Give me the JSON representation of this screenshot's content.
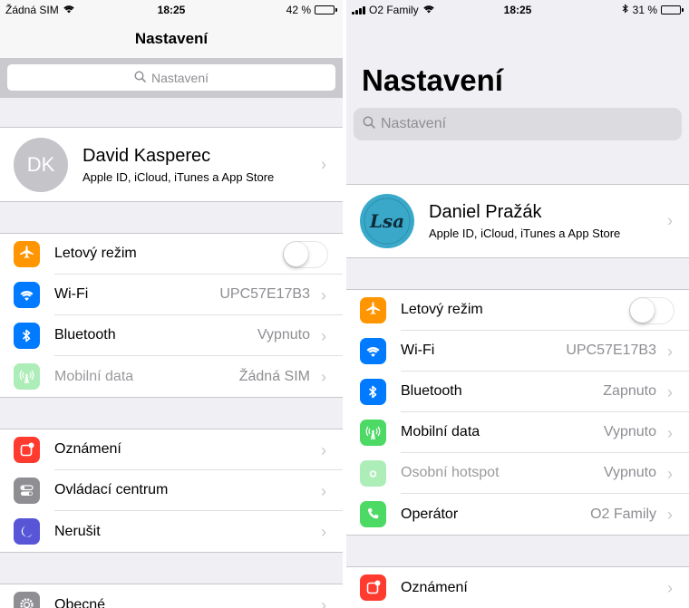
{
  "left": {
    "status": {
      "carrier": "Žádná SIM",
      "time": "18:25",
      "battery": "42 %",
      "battery_level": 0.42
    },
    "nav_title": "Nastavení",
    "search_placeholder": "Nastavení",
    "profile": {
      "initials": "DK",
      "name": "David Kasperec",
      "subtitle": "Apple ID, iCloud, iTunes a App Store"
    },
    "group1": [
      {
        "label": "Letový režim",
        "icon": "airplane-icon",
        "color": "#ff9500",
        "toggle": true
      },
      {
        "label": "Wi-Fi",
        "icon": "wifi-icon",
        "color": "#007aff",
        "value": "UPC57E17B3"
      },
      {
        "label": "Bluetooth",
        "icon": "bluetooth-icon",
        "color": "#007aff",
        "value": "Vypnuto"
      },
      {
        "label": "Mobilní data",
        "icon": "cellular-icon",
        "color": "#4cd964",
        "value": "Žádná SIM",
        "dim": true
      }
    ],
    "group2": [
      {
        "label": "Oznámení",
        "icon": "notifications-icon",
        "color": "#ff3b30"
      },
      {
        "label": "Ovládací centrum",
        "icon": "control-center-icon",
        "color": "#8e8e93"
      },
      {
        "label": "Nerušit",
        "icon": "moon-icon",
        "color": "#5856d6"
      }
    ],
    "group3": [
      {
        "label": "Obecné",
        "icon": "gear-icon",
        "color": "#8e8e93"
      }
    ]
  },
  "right": {
    "status": {
      "carrier": "O2 Family",
      "time": "18:25",
      "battery": "31 %",
      "battery_level": 0.31
    },
    "large_title": "Nastavení",
    "search_placeholder": "Nastavení",
    "profile": {
      "avatar_text": "Lsa",
      "name": "Daniel Pražák",
      "subtitle": "Apple ID, iCloud, iTunes a App Store"
    },
    "group1": [
      {
        "label": "Letový režim",
        "icon": "airplane-icon",
        "color": "#ff9500",
        "toggle": true
      },
      {
        "label": "Wi-Fi",
        "icon": "wifi-icon",
        "color": "#007aff",
        "value": "UPC57E17B3"
      },
      {
        "label": "Bluetooth",
        "icon": "bluetooth-icon",
        "color": "#007aff",
        "value": "Zapnuto"
      },
      {
        "label": "Mobilní data",
        "icon": "cellular-icon",
        "color": "#4cd964",
        "value": "Vypnuto"
      },
      {
        "label": "Osobní hotspot",
        "icon": "hotspot-icon",
        "color": "#4cd964",
        "value": "Vypnuto",
        "dim": true
      },
      {
        "label": "Operátor",
        "icon": "phone-icon",
        "color": "#4cd964",
        "value": "O2 Family"
      }
    ],
    "group2": [
      {
        "label": "Oznámení",
        "icon": "notifications-icon",
        "color": "#ff3b30"
      }
    ]
  }
}
